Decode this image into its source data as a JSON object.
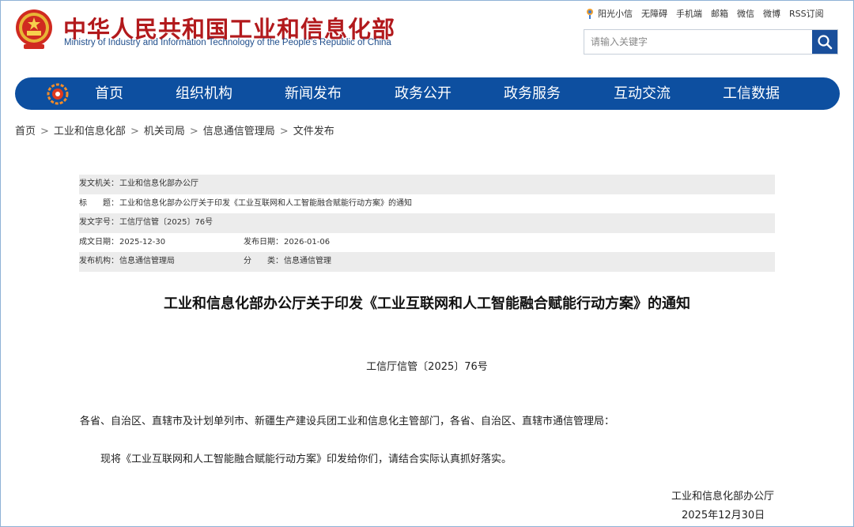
{
  "header": {
    "title_cn": "中华人民共和国工业和信息化部",
    "title_en": "Ministry of Industry and Information Technology of the People’s Republic of China",
    "top_links": [
      "阳光小信",
      "无障碍",
      "手机端",
      "邮箱",
      "微信",
      "微博",
      "RSS订阅"
    ],
    "search_placeholder": "请输入关键字",
    "colors": {
      "brand_red": "#b2191c",
      "brand_blue": "#0d4fa0"
    }
  },
  "nav": {
    "items": [
      "首页",
      "组织机构",
      "新闻发布",
      "政务公开",
      "政务服务",
      "互动交流",
      "工信数据"
    ]
  },
  "breadcrumb": [
    "首页",
    "工业和信息化部",
    "机关司局",
    "信息通信管理局",
    "文件发布"
  ],
  "info": {
    "issuer_label": "发文机关：",
    "issuer": "工业和信息化部办公厅",
    "title_label": "标　　题：",
    "title": "工业和信息化部办公厅关于印发《工业互联网和人工智能融合赋能行动方案》的通知",
    "doc_no_label": "发文字号：",
    "doc_no": "工信厅信管〔2025〕76号",
    "created_label": "成文日期：",
    "created": "2025-12-30",
    "published_label": "发布日期：",
    "published": "2026-01-06",
    "org_label": "发布机构：",
    "org": "信息通信管理局",
    "category_label": "分　　类：",
    "category": "信息通信管理"
  },
  "document": {
    "title": "工业和信息化部办公厅关于印发《工业互联网和人工智能融合赋能行动方案》的通知",
    "number": "工信厅信管〔2025〕76号",
    "recipients": "各省、自治区、直辖市及计划单列市、新疆生产建设兵团工业和信息化主管部门，各省、自治区、直辖市通信管理局：",
    "body": "现将《工业互联网和人工智能融合赋能行动方案》印发给你们，请结合实际认真抓好落实。",
    "signer": "工业和信息化部办公厅",
    "date": "2025年12月30日"
  }
}
